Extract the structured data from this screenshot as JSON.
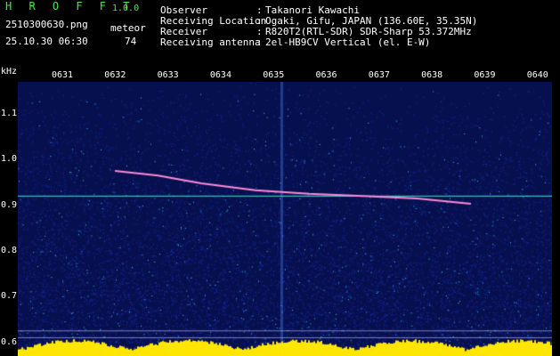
{
  "header": {
    "app_title": "H R O F F T",
    "app_version": "1.0.0",
    "filename": "2510300630.png",
    "timestamp": "25.10.30 06:30",
    "meteor_label": "meteor",
    "meteor_count": "74",
    "info": [
      {
        "label": "Observer",
        "value": "Takanori Kawachi"
      },
      {
        "label": "Receiving Location",
        "value": "Ogaki, Gifu, JAPAN (136.60E, 35.35N)"
      },
      {
        "label": "Receiver",
        "value": "R820T2(RTL-SDR) SDR-Sharp 53.372MHz"
      },
      {
        "label": "Receiving antenna",
        "value": "2el-HB9CV Vertical (el. E-W)"
      }
    ],
    "separator": ":"
  },
  "chart_data": {
    "type": "heatmap",
    "ylabel": "kHz",
    "x_ticks": [
      "0631",
      "0632",
      "0633",
      "0634",
      "0635",
      "0636",
      "0637",
      "0638",
      "0639",
      "0640"
    ],
    "y_ticks": [
      "1.1",
      "1.0",
      "0.9",
      "0.8",
      "0.7",
      "0.6"
    ],
    "ylim": [
      0.57,
      1.17
    ],
    "carrier_khz": 0.92,
    "meteor_trace": [
      {
        "t": "0632.4",
        "khz": 0.975
      },
      {
        "t": "0633.2",
        "khz": 0.965
      },
      {
        "t": "0634.0",
        "khz": 0.948
      },
      {
        "t": "0635.0",
        "khz": 0.933
      },
      {
        "t": "0636.0",
        "khz": 0.925
      },
      {
        "t": "0637.0",
        "khz": 0.92
      },
      {
        "t": "0638.0",
        "khz": 0.915
      },
      {
        "t": "0639.0",
        "khz": 0.903
      }
    ],
    "colors": {
      "background": "#07104f",
      "noise_low": "#1a2fb0",
      "noise_high": "#2fd3ff",
      "carrier": "#4de0c8",
      "trace": "#ff8ad8",
      "baseline": "#ffe600"
    }
  }
}
